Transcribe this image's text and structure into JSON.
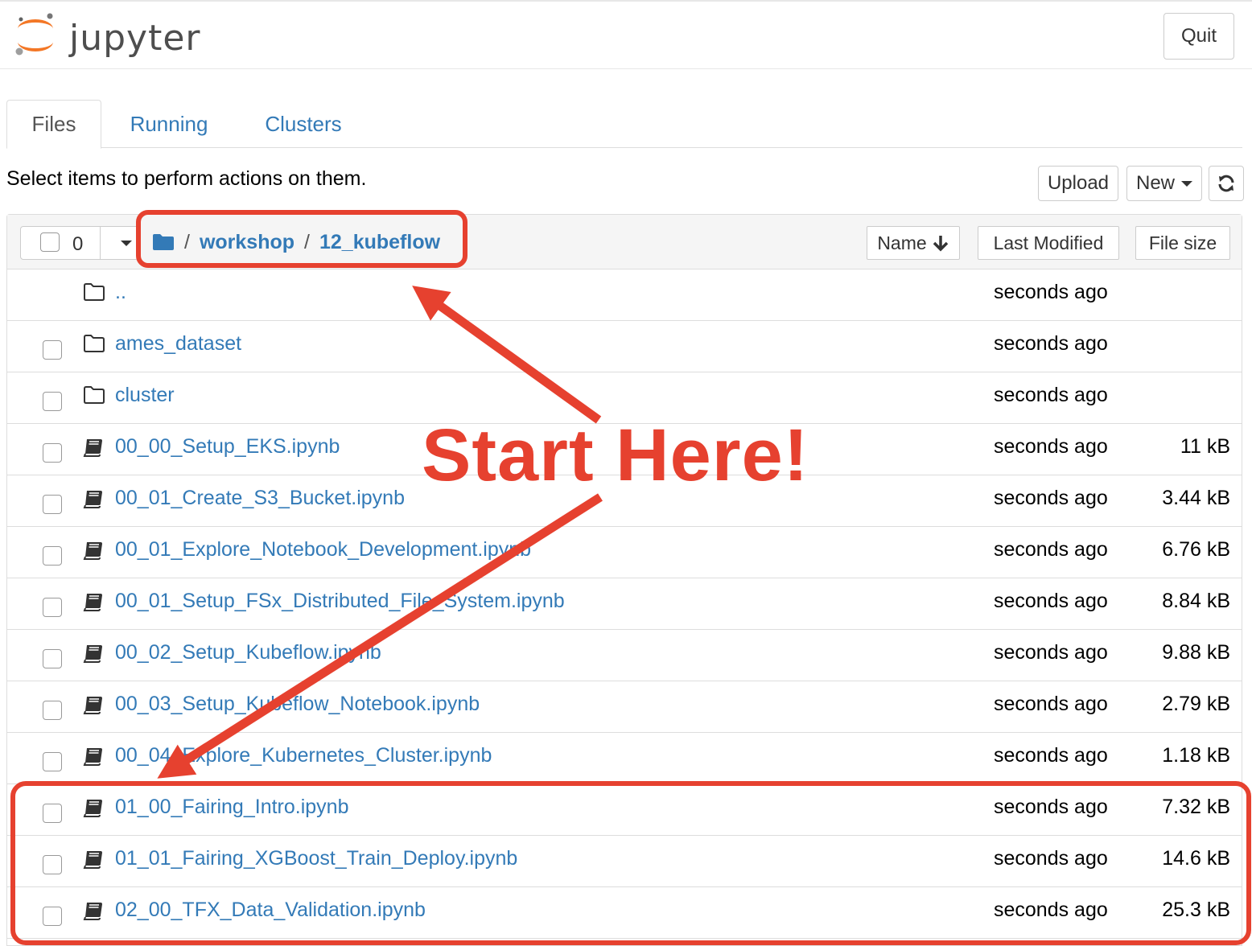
{
  "header": {
    "logo_text": "jupyter",
    "quit_label": "Quit"
  },
  "tabs": [
    {
      "label": "Files",
      "active": true
    },
    {
      "label": "Running",
      "active": false
    },
    {
      "label": "Clusters",
      "active": false
    }
  ],
  "toolbar": {
    "instructions": "Select items to perform actions on them.",
    "upload_label": "Upload",
    "new_label": "New",
    "refresh_icon": "refresh-icon"
  },
  "list_header": {
    "selected_count": "0",
    "breadcrumb": {
      "root_sep": "/",
      "items": [
        "workshop",
        "12_kubeflow"
      ],
      "sep": "/"
    },
    "sort_name_label": "Name",
    "sort_modified_label": "Last Modified",
    "sort_size_label": "File size"
  },
  "rows": [
    {
      "name": "..",
      "type": "parent",
      "modified": "seconds ago",
      "size": ""
    },
    {
      "name": "ames_dataset",
      "type": "folder",
      "modified": "seconds ago",
      "size": ""
    },
    {
      "name": "cluster",
      "type": "folder",
      "modified": "seconds ago",
      "size": ""
    },
    {
      "name": "00_00_Setup_EKS.ipynb",
      "type": "notebook",
      "modified": "seconds ago",
      "size": "11 kB"
    },
    {
      "name": "00_01_Create_S3_Bucket.ipynb",
      "type": "notebook",
      "modified": "seconds ago",
      "size": "3.44 kB"
    },
    {
      "name": "00_01_Explore_Notebook_Development.ipynb",
      "type": "notebook",
      "modified": "seconds ago",
      "size": "6.76 kB"
    },
    {
      "name": "00_01_Setup_FSx_Distributed_File_System.ipynb",
      "type": "notebook",
      "modified": "seconds ago",
      "size": "8.84 kB"
    },
    {
      "name": "00_02_Setup_Kubeflow.ipynb",
      "type": "notebook",
      "modified": "seconds ago",
      "size": "9.88 kB"
    },
    {
      "name": "00_03_Setup_Kubeflow_Notebook.ipynb",
      "type": "notebook",
      "modified": "seconds ago",
      "size": "2.79 kB"
    },
    {
      "name": "00_04_Explore_Kubernetes_Cluster.ipynb",
      "type": "notebook",
      "modified": "seconds ago",
      "size": "1.18 kB"
    },
    {
      "name": "01_00_Fairing_Intro.ipynb",
      "type": "notebook",
      "modified": "seconds ago",
      "size": "7.32 kB"
    },
    {
      "name": "01_01_Fairing_XGBoost_Train_Deploy.ipynb",
      "type": "notebook",
      "modified": "seconds ago",
      "size": "14.6 kB"
    },
    {
      "name": "02_00_TFX_Data_Validation.ipynb",
      "type": "notebook",
      "modified": "seconds ago",
      "size": "25.3 kB"
    }
  ],
  "annotation": {
    "callout_text": "Start Here!",
    "color": "#e6412f"
  },
  "colors": {
    "link": "#337ab7",
    "jupyter_orange": "#f37726",
    "annotation_red": "#e6412f"
  }
}
